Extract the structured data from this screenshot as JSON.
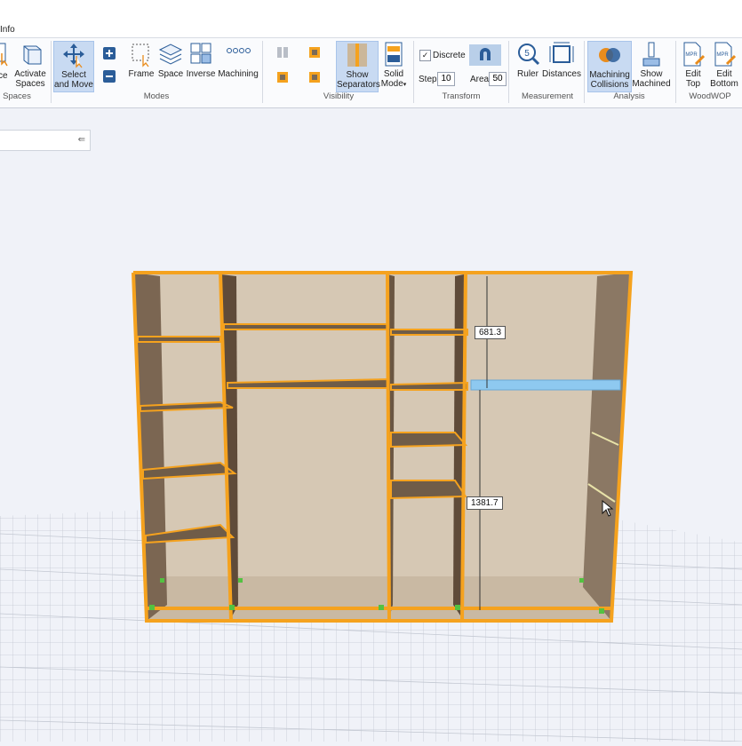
{
  "menu": {
    "info_label": "Info"
  },
  "ribbon": {
    "groups": {
      "spaces": "Spaces",
      "modes": "Modes",
      "visibility": "Visibility",
      "transform": "Transform",
      "measurement": "Measurement",
      "analysis": "Analysis",
      "woodwop": "WoodWOP"
    },
    "buttons": {
      "space_partial": "ce",
      "activate_spaces_1": "Activate",
      "activate_spaces_2": "Spaces",
      "select_move_1": "Select",
      "select_move_2": "and Move",
      "frame": "Frame",
      "space": "Space",
      "inverse": "Inverse",
      "machining": "Machining",
      "show_separators_1": "Show",
      "show_separators_2": "Separators",
      "solid_mode_1": "Solid",
      "solid_mode_2": "Mode",
      "ruler": "Ruler",
      "distances": "Distances",
      "machining_collisions_1": "Machining",
      "machining_collisions_2": "Collisions",
      "show_machined_1": "Show",
      "show_machined_2": "Machined",
      "edit_top_1": "Edit",
      "edit_top_2": "Top",
      "edit_bottom_1": "Edit",
      "edit_bottom_2": "Bottom"
    },
    "transform": {
      "discrete_label": "Discrete",
      "discrete_checked": true,
      "step_label": "Step",
      "step_value": "10",
      "area_label": "Area",
      "area_value": "50"
    },
    "icon_text": {
      "mpr": "MPR"
    }
  },
  "viewport": {
    "dimension_upper": "681.3",
    "dimension_lower": "1381.7"
  },
  "colors": {
    "frame": "#f5a21e",
    "panel": "#d6c8b4",
    "panel_dark": "#6f5c48",
    "highlight": "#8ec9f0",
    "ribbon_active": "#c8daf2"
  }
}
